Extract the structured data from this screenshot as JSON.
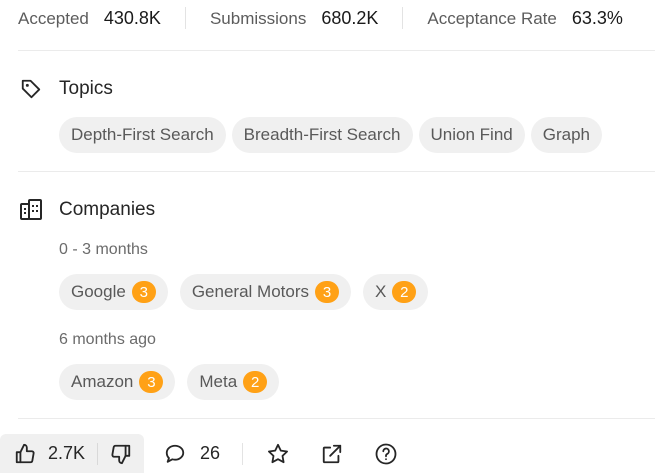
{
  "stats": [
    {
      "label": "Accepted",
      "value": "430.8K"
    },
    {
      "label": "Submissions",
      "value": "680.2K"
    },
    {
      "label": "Acceptance Rate",
      "value": "63.3%"
    }
  ],
  "topics": {
    "title": "Topics",
    "icon": "tag-icon",
    "tags": [
      "Depth-First Search",
      "Breadth-First Search",
      "Union Find",
      "Graph"
    ]
  },
  "companies": {
    "title": "Companies",
    "icon": "building-icon",
    "groups": [
      {
        "period": "0 - 3 months",
        "items": [
          {
            "name": "Google",
            "count": "3"
          },
          {
            "name": "General Motors",
            "count": "3"
          },
          {
            "name": "X",
            "count": "2"
          }
        ]
      },
      {
        "period": "6 months ago",
        "items": [
          {
            "name": "Amazon",
            "count": "3"
          },
          {
            "name": "Meta",
            "count": "2"
          }
        ]
      }
    ]
  },
  "actions": {
    "likes": "2.7K",
    "comments": "26",
    "icons": [
      "thumbs-up-icon",
      "thumbs-down-icon",
      "comment-icon",
      "star-icon",
      "external-link-icon",
      "help-icon"
    ]
  },
  "colors": {
    "badge": "#ffa116",
    "chip_bg": "#f0f0f0",
    "text": "#262626"
  }
}
